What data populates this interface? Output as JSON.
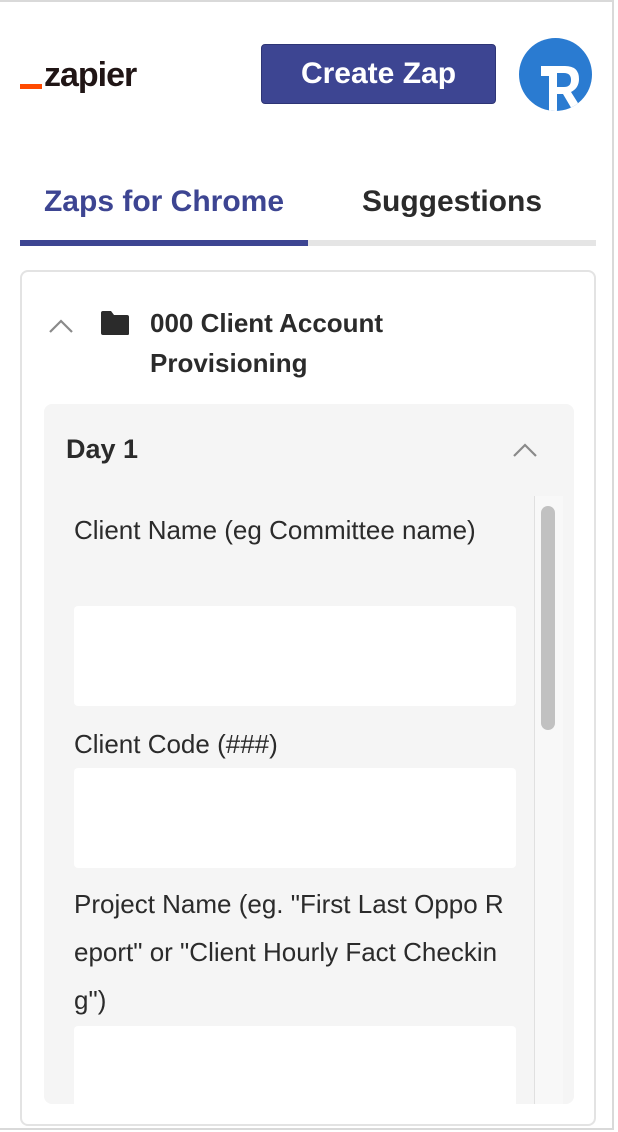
{
  "header": {
    "logo_text": "zapier",
    "create_button_label": "Create Zap",
    "avatar_initial": "R",
    "brand_color": "#3d4592",
    "logo_accent_color": "#ff4a00",
    "avatar_color": "#2a7bd1"
  },
  "tabs": [
    {
      "label": "Zaps for Chrome",
      "active": true
    },
    {
      "label": "Suggestions",
      "active": false
    }
  ],
  "folder": {
    "title": "000 Client Account Provisioning",
    "icon": "folder-icon",
    "expanded": true
  },
  "section": {
    "title": "Day 1",
    "expanded": true,
    "fields": [
      {
        "label": "Client Name (eg Committee name)",
        "value": ""
      },
      {
        "label": "Client Code (###)",
        "value": ""
      },
      {
        "label": "Project Name (eg. \"First Last Oppo Report\" or \"Client Hourly Fact Checking\")",
        "value": ""
      }
    ]
  }
}
